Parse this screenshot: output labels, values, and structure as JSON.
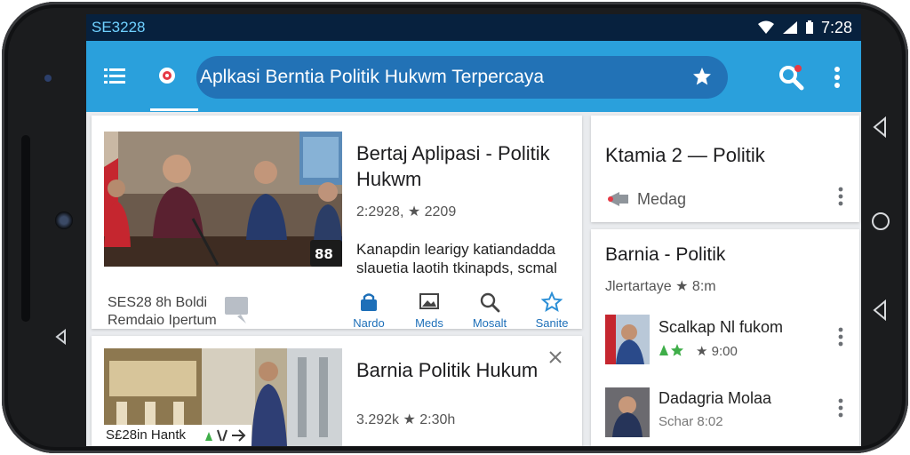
{
  "status_bar": {
    "carrier": "SE3228",
    "time": "7:28"
  },
  "app_bar": {
    "search_text": "Aplkasi Berntia Politik Hukwm Terpercaya"
  },
  "main_card": {
    "title": "Bertaj Aplipasi - Politik Hukwm",
    "meta": "2:2928, ★ 2209",
    "body": "Kanapdin learigy katiandadda slauetia laotih tkinapds, scmal",
    "badge": "88",
    "footer_line1": "SES28 8h Boldi",
    "footer_line2": "Remdaio Ipertum",
    "actions": [
      {
        "icon": "bag-icon",
        "label": "Nardo"
      },
      {
        "icon": "image-icon",
        "label": "Meds"
      },
      {
        "icon": "search-icon",
        "label": "Mosalt"
      },
      {
        "icon": "star-icon",
        "label": "Sanite"
      }
    ]
  },
  "second_card": {
    "title": "Barnia Politik Hukum",
    "meta": "3.292k ★ 2:30h",
    "footer": "S£28in Hantk"
  },
  "side_card_top": {
    "title": "Ktamia 2 — Politik",
    "source": "Medag"
  },
  "side_card_list": {
    "title": "Barnia - Politik",
    "meta": "Jlertartaye ★ 8:m",
    "items": [
      {
        "title": "Scalkap Nl fukom",
        "meta": "★ 9:00"
      },
      {
        "title": "Dadagria Molaa",
        "meta": "Schar 8:02"
      }
    ]
  },
  "colors": {
    "app_bar": "#2aa0dc",
    "search_pill": "#2272b6",
    "status_bar": "#07213e",
    "action_blue": "#1d6fb8",
    "star_gold": "#e6a817",
    "star_green": "#3fae49"
  }
}
